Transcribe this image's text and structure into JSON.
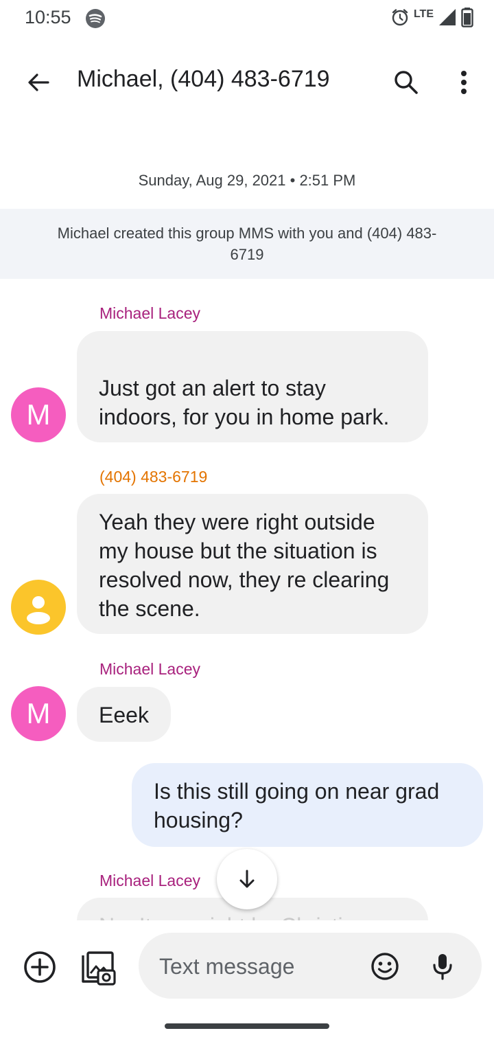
{
  "status_bar": {
    "time": "10:55",
    "network": "LTE",
    "icons": [
      "spotify-icon",
      "alarm-icon",
      "signal-icon",
      "battery-icon"
    ]
  },
  "header": {
    "title": "Michael, (404) 483-6719",
    "icons": [
      "back-arrow-icon",
      "search-icon",
      "more-vert-icon"
    ]
  },
  "conversation": {
    "date_separator": "Sunday, Aug 29, 2021 • 2:51 PM",
    "system_message": "Michael created this group MMS with you and (404) 483-6719",
    "messages": [
      {
        "sender": "Michael Lacey",
        "avatar_letter": "M",
        "text": "Just got an alert to stay indoors, for you in home park.",
        "direction": "incoming"
      },
      {
        "sender": "(404) 483-6719",
        "avatar_letter": "",
        "text": "Yeah they were right outside my house but the situation is resolved now, they re clearing the scene.",
        "direction": "incoming"
      },
      {
        "sender": "Michael Lacey",
        "avatar_letter": "M",
        "text": "Eeek",
        "direction": "incoming"
      },
      {
        "sender": "",
        "avatar_letter": "",
        "text": "Is this still going on near grad housing?",
        "direction": "outgoing"
      },
      {
        "sender": "Michael Lacey",
        "avatar_letter": "M",
        "text": "No. It was right by Christina.",
        "direction": "incoming"
      }
    ]
  },
  "composer": {
    "placeholder": "Text message",
    "icons": [
      "add-circle-icon",
      "gallery-icon",
      "emoji-icon",
      "mic-icon"
    ]
  },
  "colors": {
    "sender_purple": "#a8217d",
    "sender_orange": "#e37400",
    "avatar_pink": "#f55dbf",
    "avatar_yellow": "#fbc52b",
    "incoming_bubble": "#f1f1f1",
    "outgoing_bubble": "#e8effc",
    "system_banner": "#f2f4f8"
  }
}
